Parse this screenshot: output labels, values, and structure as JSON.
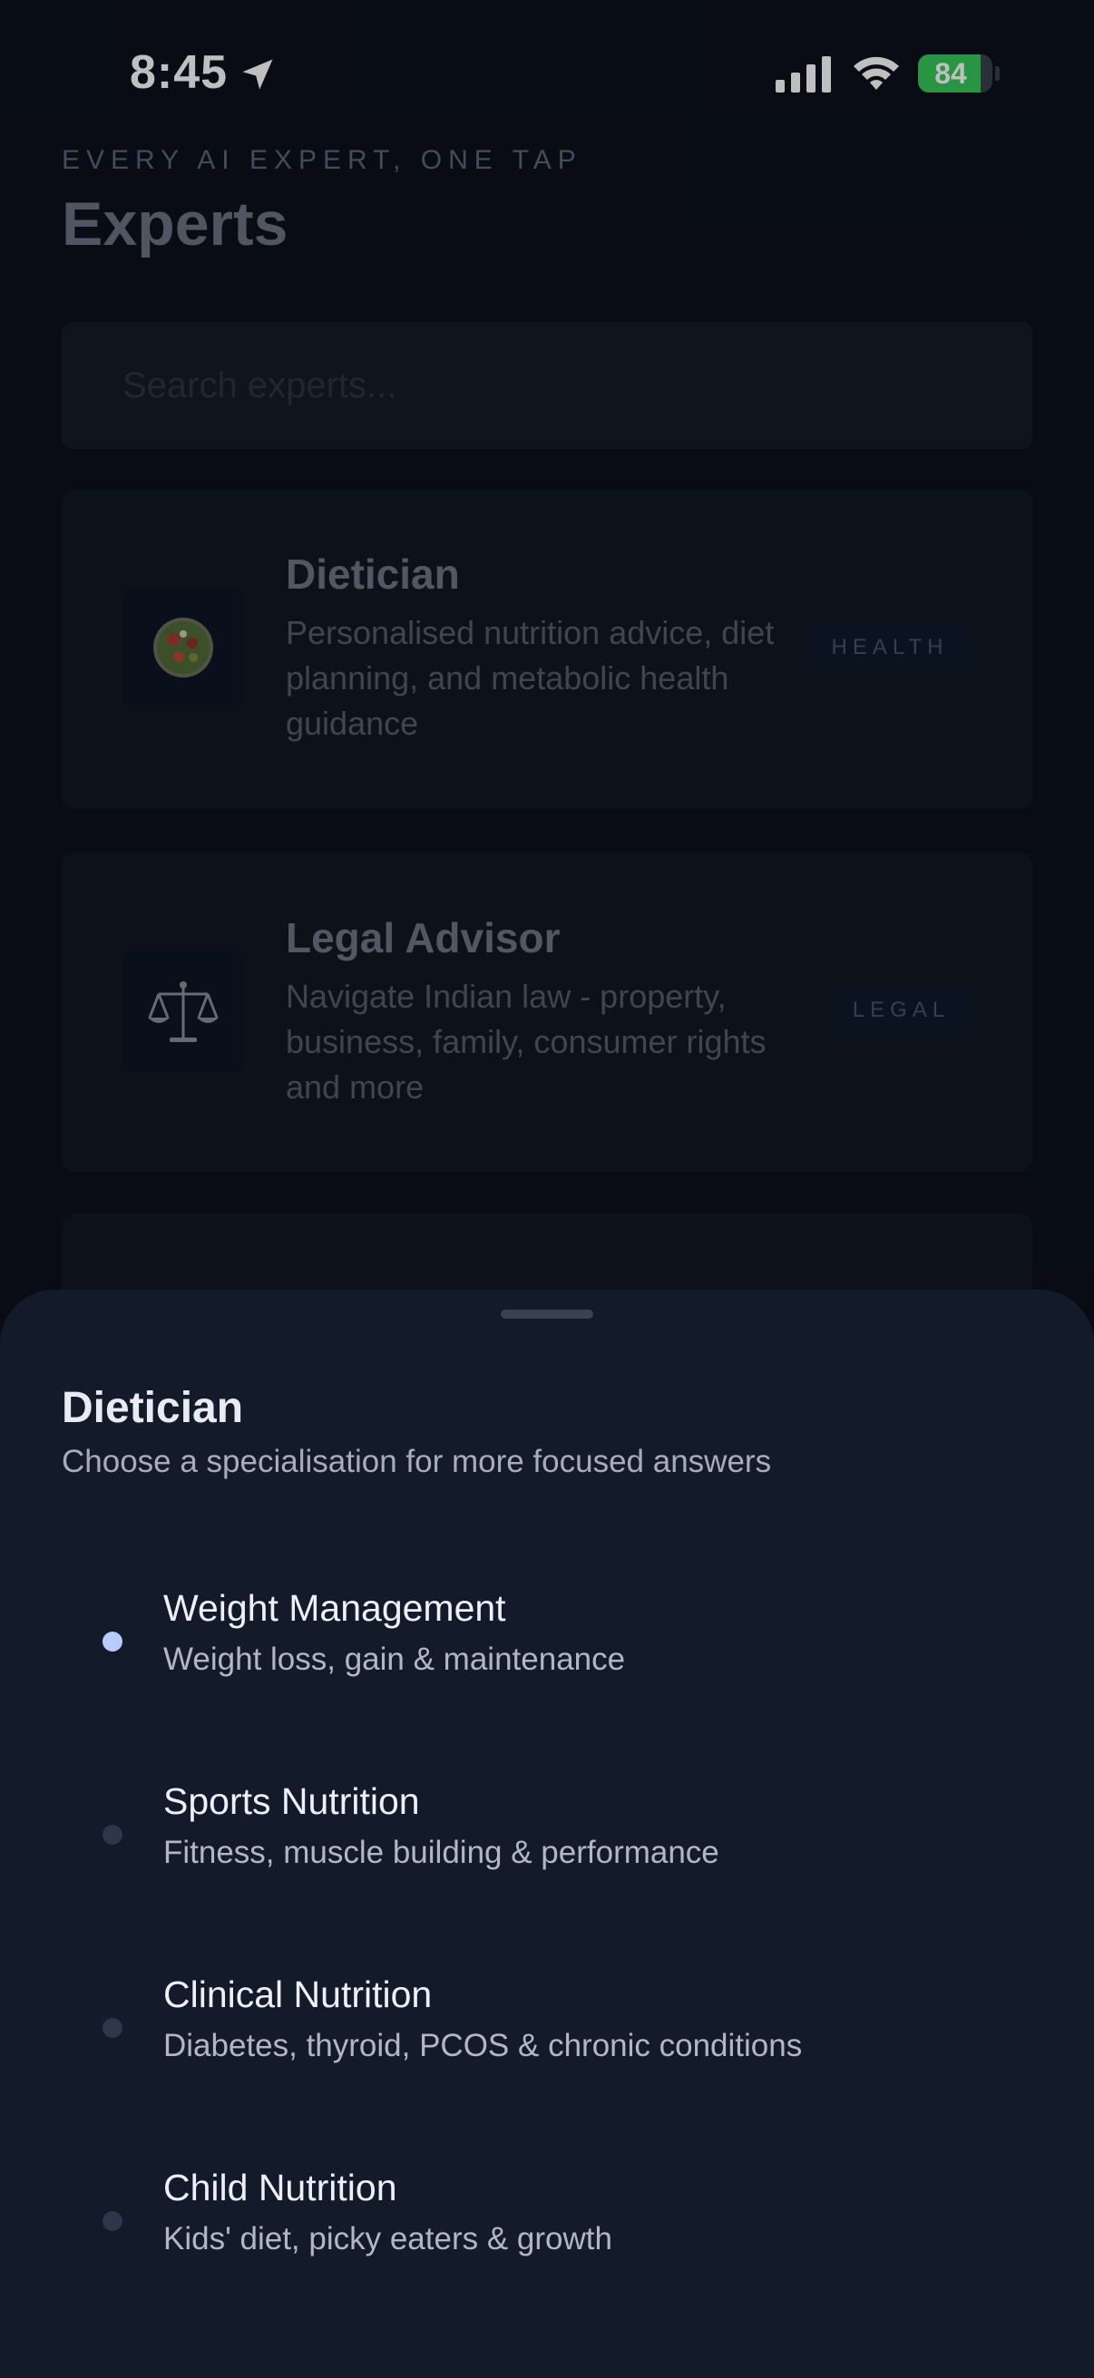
{
  "status_bar": {
    "time": "8:45",
    "battery": "84",
    "battery_level": 0.84,
    "icons": [
      "location-arrow-icon",
      "signal-icon",
      "wifi-icon",
      "battery-icon"
    ]
  },
  "header": {
    "eyebrow": "EVERY AI EXPERT, ONE TAP",
    "title": "Experts"
  },
  "search": {
    "placeholder": "Search experts..."
  },
  "cards": [
    {
      "title": "Dietician",
      "description": "Personalised nutrition advice, diet planning, and metabolic health guidance",
      "badge": "HEALTH",
      "icon": "salad-bowl-icon"
    },
    {
      "title": "Legal Advisor",
      "description": "Navigate Indian law - property, business, family, consumer rights and more",
      "badge": "LEGAL",
      "icon": "scales-icon"
    }
  ],
  "sheet": {
    "title": "Dietician",
    "subtitle": "Choose a specialisation for more focused answers",
    "options": [
      {
        "title": "Weight Management",
        "description": "Weight loss, gain & maintenance",
        "selected": true
      },
      {
        "title": "Sports Nutrition",
        "description": "Fitness, muscle building & performance",
        "selected": false
      },
      {
        "title": "Clinical Nutrition",
        "description": "Diabetes, thyroid, PCOS & chronic conditions",
        "selected": false
      },
      {
        "title": "Child Nutrition",
        "description": "Kids' diet, picky eaters & growth",
        "selected": false
      }
    ]
  },
  "colors": {
    "background": "#0c111c",
    "sheet": "#131a2a",
    "accent": "#b8ccff",
    "battery": "#34c759"
  }
}
